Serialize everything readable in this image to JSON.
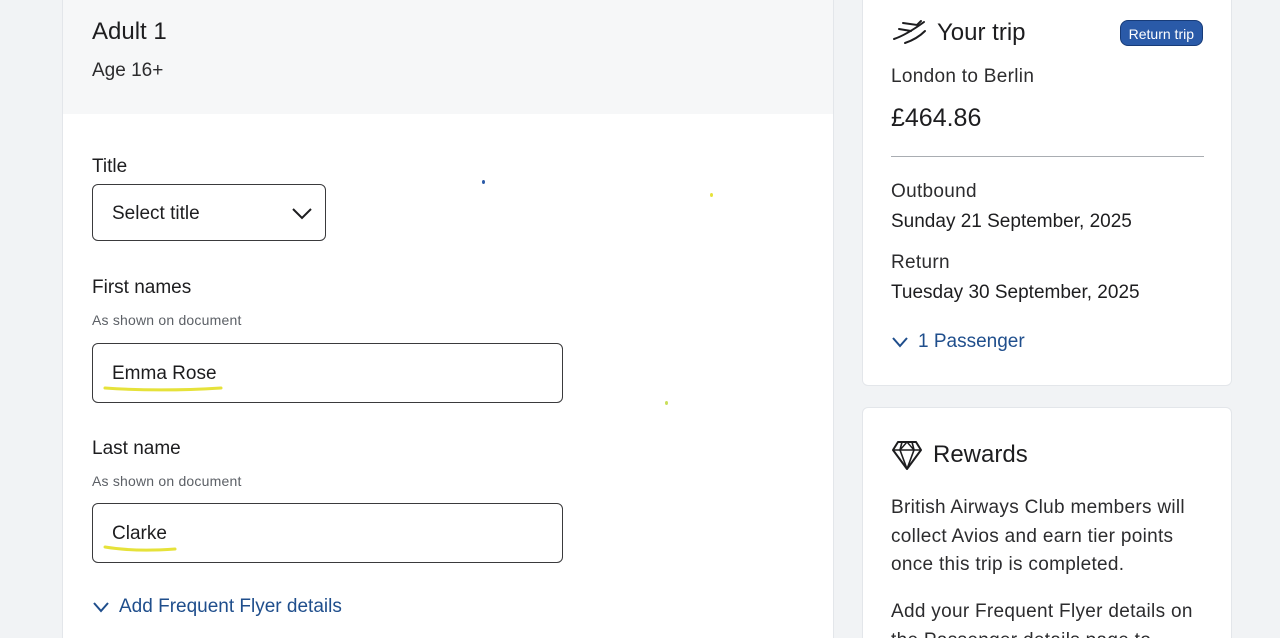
{
  "passenger": {
    "title": "Adult 1",
    "subtitle": "Age 16+",
    "title_field": {
      "label": "Title",
      "selected": "Select title"
    },
    "first_names": {
      "label": "First names",
      "hint": "As shown on document",
      "value": "Emma Rose"
    },
    "last_name": {
      "label": "Last name",
      "hint": "As shown on document",
      "value": "Clarke"
    },
    "frequent_flyer_link": "Add Frequent Flyer details"
  },
  "trip": {
    "title": "Your trip",
    "badge": "Return trip",
    "route": "London to Berlin",
    "price": "£464.86",
    "outbound_label": "Outbound",
    "outbound_date": "Sunday 21 September, 2025",
    "return_label": "Return",
    "return_date": "Tuesday 30 September, 2025",
    "passengers_toggle": "1 Passenger"
  },
  "rewards": {
    "title": "Rewards",
    "text1": "British Airways Club members will collect Avios and earn tier points once this trip is completed.",
    "text2": "Add your Frequent Flyer details on the Passenger details page to"
  },
  "colors": {
    "link": "#1f4e8c",
    "badge": "#2a5aa8",
    "highlight": "#e6e23a",
    "background": "#f1f3f5"
  },
  "icons": {
    "trip": "plane-takeoff-icon",
    "rewards": "diamond-icon",
    "select": "chevron-down-icon",
    "expand": "chevron-down-icon"
  }
}
